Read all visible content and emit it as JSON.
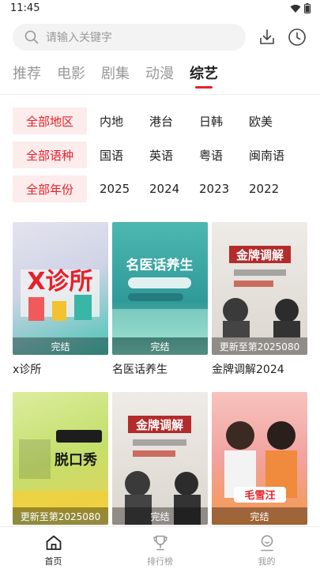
{
  "status": {
    "time": "11:45"
  },
  "search": {
    "placeholder": "请输入关键字"
  },
  "tabs": [
    {
      "label": "推荐"
    },
    {
      "label": "电影"
    },
    {
      "label": "剧集"
    },
    {
      "label": "动漫"
    },
    {
      "label": "综艺",
      "active": true
    }
  ],
  "filters": {
    "region": {
      "chip": "全部地区",
      "options": [
        "内地",
        "港台",
        "日韩",
        "欧美"
      ]
    },
    "language": {
      "chip": "全部语种",
      "options": [
        "国语",
        "英语",
        "粤语",
        "闽南语"
      ]
    },
    "year": {
      "chip": "全部年份",
      "options": [
        "2025",
        "2024",
        "2023",
        "2022"
      ]
    }
  },
  "cards": [
    {
      "title": "x诊所",
      "badge": "完结",
      "poster_text": "X诊所",
      "colors": [
        "#d9d9e6",
        "#3fc1b3"
      ]
    },
    {
      "title": "名医话养生",
      "badge": "完结",
      "poster_text": "名医话养生",
      "colors": [
        "#3aa6a2",
        "#9ee0cf"
      ]
    },
    {
      "title": "金牌调解2024",
      "badge": "更新至第2025080",
      "poster_text": "金牌调解",
      "colors": [
        "#e9e6e2",
        "#b32b2b"
      ]
    },
    {
      "title": "",
      "badge": "更新至第2025080",
      "poster_text": "脱口秀",
      "colors": [
        "#c8e07a",
        "#f2d24a"
      ]
    },
    {
      "title": "",
      "badge": "完结",
      "poster_text": "金牌调解",
      "colors": [
        "#ebe7e2",
        "#b32b2b"
      ]
    },
    {
      "title": "",
      "badge": "完结",
      "poster_text": "毛雪汪",
      "colors": [
        "#f6b7b0",
        "#f39b4b"
      ]
    }
  ],
  "nav": [
    {
      "label": "首页",
      "icon": "home-icon",
      "active": true
    },
    {
      "label": "排行榜",
      "icon": "trophy-icon"
    },
    {
      "label": "我的",
      "icon": "user-icon"
    }
  ]
}
